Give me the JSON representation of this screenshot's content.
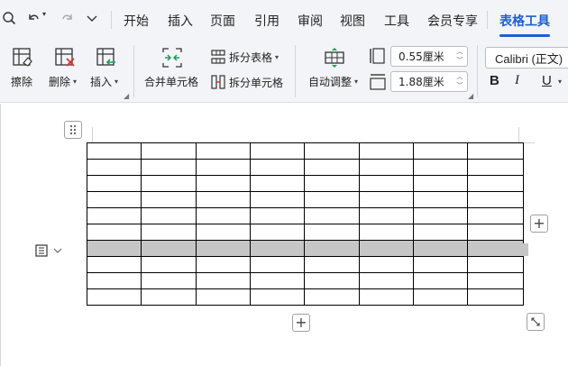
{
  "menu": {
    "tabs": [
      {
        "label": "开始"
      },
      {
        "label": "插入"
      },
      {
        "label": "页面"
      },
      {
        "label": "引用"
      },
      {
        "label": "审阅"
      },
      {
        "label": "视图"
      },
      {
        "label": "工具"
      },
      {
        "label": "会员专享"
      },
      {
        "label": "表格工具"
      }
    ],
    "active_tab": "表格工具",
    "active_color": "#1f5fd1"
  },
  "quick_access": {
    "icons": [
      "print-preview-icon",
      "undo-icon",
      "redo-icon",
      "more-chevron-icon"
    ]
  },
  "ribbon": {
    "erase_label": "擦除",
    "delete_label": "删除",
    "insert_label": "插入",
    "merge_label": "合并单元格",
    "split_table_label": "拆分表格",
    "split_cells_label": "拆分单元格",
    "autofit_label": "自动调整",
    "col_width_value": "0.55厘米",
    "row_height_value": "1.88厘米",
    "font_name": "Calibri (正文)",
    "bold_label": "B",
    "italic_label": "I",
    "underline_label": "U"
  },
  "table": {
    "columns": 8,
    "rows": 10,
    "selected_row_index": 6,
    "selected_color": "#c6c6c6"
  },
  "buttons": {
    "add_column": "+",
    "add_row": "+"
  }
}
